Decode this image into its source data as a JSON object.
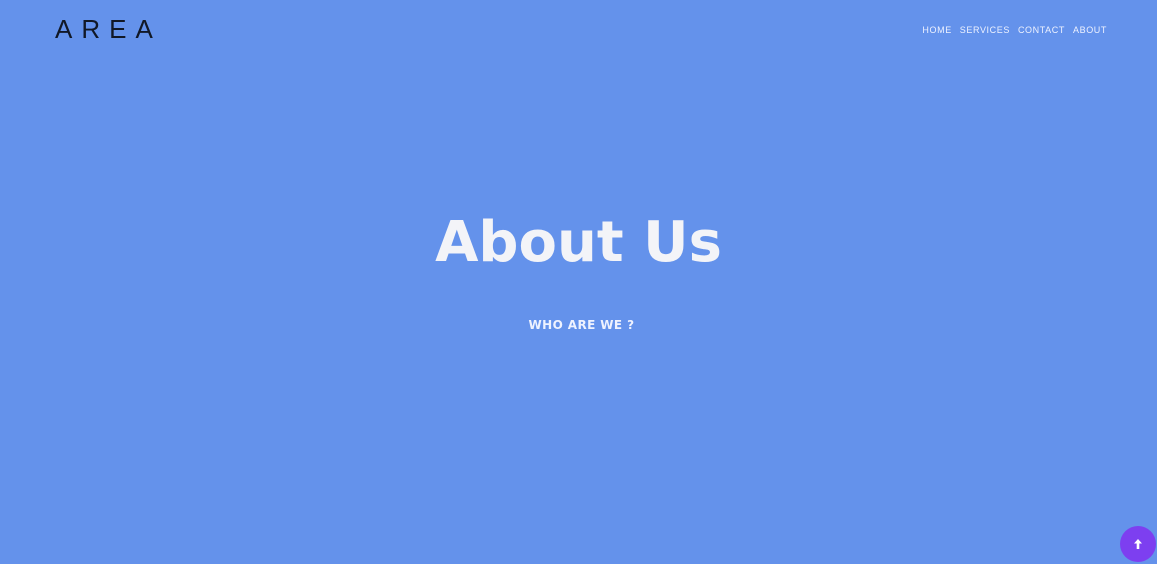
{
  "header": {
    "logo": "AREA",
    "nav": [
      {
        "label": "HOME"
      },
      {
        "label": "SERVICES"
      },
      {
        "label": "CONTACT"
      },
      {
        "label": "ABOUT"
      }
    ]
  },
  "hero": {
    "title": "About Us",
    "subtitle": "WHO ARE WE ?"
  },
  "scroll_top": {
    "icon": "arrow-up-icon"
  },
  "colors": {
    "background": "#6492eb",
    "accent": "#7d3ff0",
    "logo": "#111827"
  }
}
